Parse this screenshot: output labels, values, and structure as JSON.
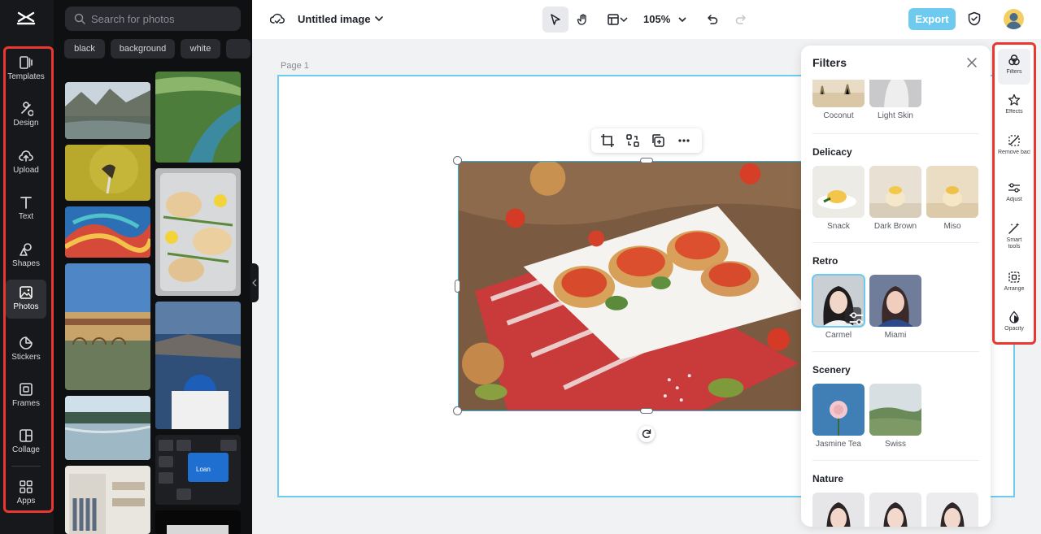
{
  "app": {
    "document_title": "Untitled image",
    "zoom": "105%",
    "export_label": "Export",
    "page_label": "Page 1",
    "accent_color": "#6ecbef",
    "highlight_color": "#e8382f"
  },
  "left_nav": {
    "items": [
      {
        "label": "Templates",
        "icon": "templates-icon"
      },
      {
        "label": "Design",
        "icon": "design-icon"
      },
      {
        "label": "Upload",
        "icon": "upload-icon"
      },
      {
        "label": "Text",
        "icon": "text-icon"
      },
      {
        "label": "Shapes",
        "icon": "shapes-icon"
      },
      {
        "label": "Photos",
        "icon": "photos-icon",
        "active": true
      },
      {
        "label": "Stickers",
        "icon": "stickers-icon"
      },
      {
        "label": "Frames",
        "icon": "frames-icon"
      },
      {
        "label": "Collage",
        "icon": "collage-icon"
      },
      {
        "label": "Apps",
        "icon": "apps-icon"
      }
    ]
  },
  "photos_panel": {
    "search_placeholder": "Search for photos",
    "chips": [
      "black",
      "background",
      "white"
    ]
  },
  "filters_panel": {
    "title": "Filters",
    "top_row": [
      "Coconut",
      "Light Skin"
    ],
    "sections": [
      {
        "title": "Delicacy",
        "items": [
          "Snack",
          "Dark Brown",
          "Miso"
        ]
      },
      {
        "title": "Retro",
        "items": [
          "Carmel",
          "Miami"
        ]
      },
      {
        "title": "Scenery",
        "items": [
          "Jasmine Tea",
          "Swiss"
        ]
      },
      {
        "title": "Nature",
        "items": []
      }
    ]
  },
  "right_rail": {
    "items": [
      {
        "label": "Filters",
        "icon": "filters-icon",
        "active": true
      },
      {
        "label": "Effects",
        "icon": "effects-icon"
      },
      {
        "label": "Remove backgro...",
        "icon": "remove-background-icon"
      },
      {
        "label": "Adjust",
        "icon": "adjust-icon"
      },
      {
        "label": "Smart tools",
        "icon": "smart-tools-icon"
      },
      {
        "label": "Arrange",
        "icon": "arrange-icon"
      },
      {
        "label": "Opacity",
        "icon": "opacity-icon"
      }
    ]
  }
}
